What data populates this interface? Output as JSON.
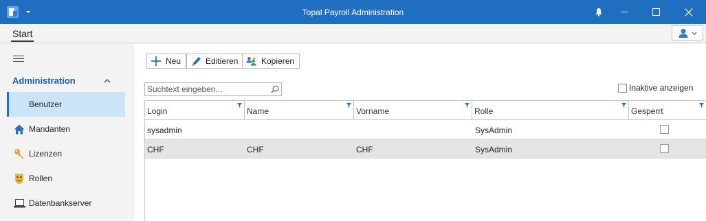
{
  "window": {
    "title": "Topal Payroll Administration"
  },
  "ribbon": {
    "tab_start": "Start"
  },
  "sidebar": {
    "section": "Administration",
    "items": [
      {
        "label": "Benutzer",
        "icon": "user-icon",
        "active": true
      },
      {
        "label": "Mandanten",
        "icon": "home-icon"
      },
      {
        "label": "Lizenzen",
        "icon": "key-icon"
      },
      {
        "label": "Rollen",
        "icon": "mask-icon"
      },
      {
        "label": "Datenbankserver",
        "icon": "laptop-icon"
      }
    ]
  },
  "toolbar": {
    "new_label": "Neu",
    "edit_label": "Editieren",
    "copy_label": "Kopieren"
  },
  "search": {
    "placeholder": "Suchtext eingeben..."
  },
  "filter": {
    "inactive_label": "Inaktive anzeigen",
    "inactive_checked": false
  },
  "grid": {
    "columns": [
      "Login",
      "Name",
      "Vorname",
      "Rolle",
      "Gesperrt"
    ],
    "rows": [
      {
        "login": "sysadmin",
        "name": "",
        "vorname": "",
        "rolle": "SysAdmin",
        "gesperrt": false
      },
      {
        "login": "CHF",
        "name": "CHF",
        "vorname": "CHF",
        "rolle": "SysAdmin",
        "gesperrt": false
      }
    ]
  },
  "colors": {
    "titlebar": "#1f6ec0",
    "accent": "#1e5aa0",
    "active_nav": "#cce4f7"
  }
}
